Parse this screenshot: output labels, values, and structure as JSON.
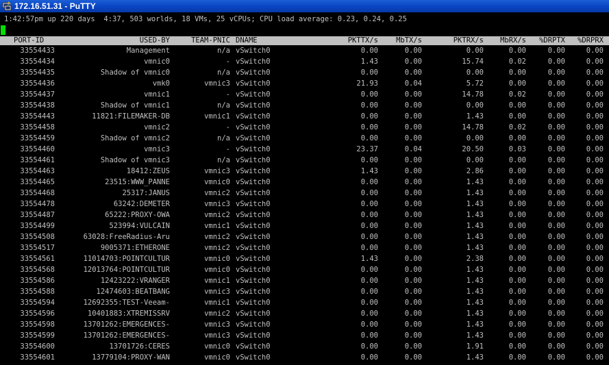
{
  "window": {
    "title": "172.16.51.31 - PuTTY",
    "app_icon": "putty-icon"
  },
  "terminal": {
    "status_line": "1:42:57pm up 220 days  4:37, 503 worlds, 18 VMs, 25 vCPUs; CPU load average: 0.23, 0.24, 0.25",
    "headers": [
      "PORT-ID",
      "USED-BY",
      "TEAM-PNIC",
      "DNAME",
      "PKTTX/s",
      "MbTX/s",
      "PKTRX/s",
      "MbRX/s",
      "%DRPTX",
      "%DRPRX"
    ],
    "rows": [
      [
        "33554433",
        "Management",
        "n/a",
        "vSwitch0",
        "0.00",
        "0.00",
        "0.00",
        "0.00",
        "0.00",
        "0.00"
      ],
      [
        "33554434",
        "vmnic0",
        "-",
        "vSwitch0",
        "1.43",
        "0.00",
        "15.74",
        "0.02",
        "0.00",
        "0.00"
      ],
      [
        "33554435",
        "Shadow of vmnic0",
        "n/a",
        "vSwitch0",
        "0.00",
        "0.00",
        "0.00",
        "0.00",
        "0.00",
        "0.00"
      ],
      [
        "33554436",
        "vmk0",
        "vmnic3",
        "vSwitch0",
        "21.93",
        "0.04",
        "5.72",
        "0.00",
        "0.00",
        "0.00"
      ],
      [
        "33554437",
        "vmnic1",
        "-",
        "vSwitch0",
        "0.00",
        "0.00",
        "14.78",
        "0.02",
        "0.00",
        "0.00"
      ],
      [
        "33554438",
        "Shadow of vmnic1",
        "n/a",
        "vSwitch0",
        "0.00",
        "0.00",
        "0.00",
        "0.00",
        "0.00",
        "0.00"
      ],
      [
        "33554443",
        "11821:FILEMAKER-DB",
        "vmnic1",
        "vSwitch0",
        "0.00",
        "0.00",
        "1.43",
        "0.00",
        "0.00",
        "0.00"
      ],
      [
        "33554458",
        "vmnic2",
        "-",
        "vSwitch0",
        "0.00",
        "0.00",
        "14.78",
        "0.02",
        "0.00",
        "0.00"
      ],
      [
        "33554459",
        "Shadow of vmnic2",
        "n/a",
        "vSwitch0",
        "0.00",
        "0.00",
        "0.00",
        "0.00",
        "0.00",
        "0.00"
      ],
      [
        "33554460",
        "vmnic3",
        "-",
        "vSwitch0",
        "23.37",
        "0.04",
        "20.50",
        "0.03",
        "0.00",
        "0.00"
      ],
      [
        "33554461",
        "Shadow of vmnic3",
        "n/a",
        "vSwitch0",
        "0.00",
        "0.00",
        "0.00",
        "0.00",
        "0.00",
        "0.00"
      ],
      [
        "33554463",
        "18412:ZEUS",
        "vmnic3",
        "vSwitch0",
        "1.43",
        "0.00",
        "2.86",
        "0.00",
        "0.00",
        "0.00"
      ],
      [
        "33554465",
        "23515:WWW_PANNE",
        "vmnic0",
        "vSwitch0",
        "0.00",
        "0.00",
        "1.43",
        "0.00",
        "0.00",
        "0.00"
      ],
      [
        "33554468",
        "25317:JANUS",
        "vmnic2",
        "vSwitch0",
        "0.00",
        "0.00",
        "1.43",
        "0.00",
        "0.00",
        "0.00"
      ],
      [
        "33554478",
        "63242:DEMETER",
        "vmnic3",
        "vSwitch0",
        "0.00",
        "0.00",
        "1.43",
        "0.00",
        "0.00",
        "0.00"
      ],
      [
        "33554487",
        "65222:PROXY-OWA",
        "vmnic2",
        "vSwitch0",
        "0.00",
        "0.00",
        "1.43",
        "0.00",
        "0.00",
        "0.00"
      ],
      [
        "33554499",
        "523994:VULCAIN",
        "vmnic1",
        "vSwitch0",
        "0.00",
        "0.00",
        "1.43",
        "0.00",
        "0.00",
        "0.00"
      ],
      [
        "33554508",
        "63028:FreeRadius-Aru",
        "vmnic2",
        "vSwitch0",
        "0.00",
        "0.00",
        "1.43",
        "0.00",
        "0.00",
        "0.00"
      ],
      [
        "33554517",
        "9005371:ETHERONE",
        "vmnic2",
        "vSwitch0",
        "0.00",
        "0.00",
        "1.43",
        "0.00",
        "0.00",
        "0.00"
      ],
      [
        "33554561",
        "11014703:POINTCULTUR",
        "vmnic0",
        "vSwitch0",
        "1.43",
        "0.00",
        "2.38",
        "0.00",
        "0.00",
        "0.00"
      ],
      [
        "33554568",
        "12013764:POINTCULTUR",
        "vmnic0",
        "vSwitch0",
        "0.00",
        "0.00",
        "1.43",
        "0.00",
        "0.00",
        "0.00"
      ],
      [
        "33554586",
        "12423222:VRANGER",
        "vmnic1",
        "vSwitch0",
        "0.00",
        "0.00",
        "1.43",
        "0.00",
        "0.00",
        "0.00"
      ],
      [
        "33554588",
        "12474603:BEATBANG",
        "vmnic3",
        "vSwitch0",
        "0.00",
        "0.00",
        "1.43",
        "0.00",
        "0.00",
        "0.00"
      ],
      [
        "33554594",
        "12692355:TEST-Veeam-",
        "vmnic1",
        "vSwitch0",
        "0.00",
        "0.00",
        "1.43",
        "0.00",
        "0.00",
        "0.00"
      ],
      [
        "33554596",
        "10401883:XTREMISSRV",
        "vmnic2",
        "vSwitch0",
        "0.00",
        "0.00",
        "1.43",
        "0.00",
        "0.00",
        "0.00"
      ],
      [
        "33554598",
        "13701262:EMERGENCES-",
        "vmnic3",
        "vSwitch0",
        "0.00",
        "0.00",
        "1.43",
        "0.00",
        "0.00",
        "0.00"
      ],
      [
        "33554599",
        "13701262:EMERGENCES-",
        "vmnic3",
        "vSwitch0",
        "0.00",
        "0.00",
        "1.43",
        "0.00",
        "0.00",
        "0.00"
      ],
      [
        "33554600",
        "13701726:CERES",
        "vmnic0",
        "vSwitch0",
        "0.00",
        "0.00",
        "1.91",
        "0.00",
        "0.00",
        "0.00"
      ],
      [
        "33554601",
        "13779104:PROXY-WAN",
        "vmnic0",
        "vSwitch0",
        "0.00",
        "0.00",
        "1.43",
        "0.00",
        "0.00",
        "0.00"
      ]
    ]
  },
  "colors": {
    "terminal_bg": "#000000",
    "terminal_fg": "#c0c0c0",
    "header_bg": "#c0c0c0",
    "cursor": "#00e000",
    "titlebar": "#0a46c4"
  }
}
